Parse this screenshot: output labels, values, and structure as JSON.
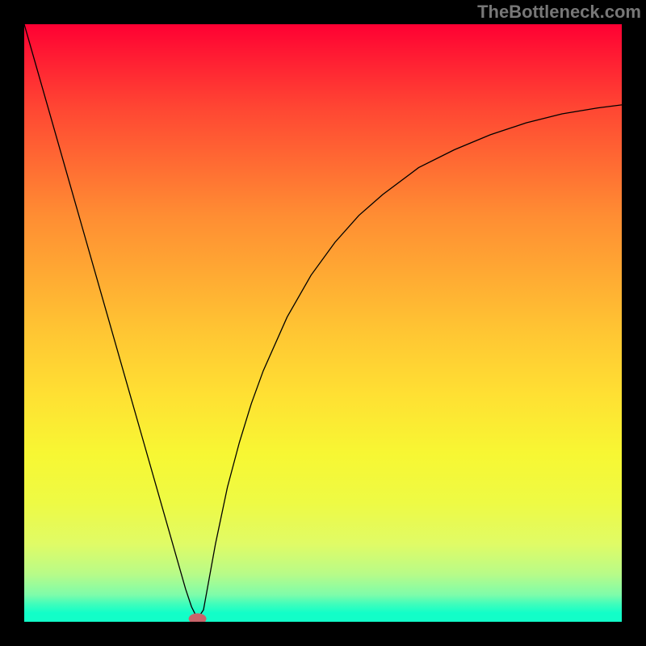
{
  "watermark": {
    "text": "TheBottleneck.com"
  },
  "chart_data": {
    "type": "line",
    "title": "",
    "xlabel": "",
    "ylabel": "",
    "xlim": [
      0,
      100
    ],
    "ylim": [
      0,
      100
    ],
    "series": [
      {
        "name": "bottleneck-curve",
        "x": [
          0,
          2,
          4,
          6,
          8,
          10,
          12,
          14,
          16,
          18,
          20,
          22,
          24,
          26,
          27,
          28,
          29,
          30,
          31,
          32,
          34,
          36,
          38,
          40,
          44,
          48,
          52,
          56,
          60,
          66,
          72,
          78,
          84,
          90,
          96,
          100
        ],
        "y": [
          100,
          93,
          86,
          79,
          72,
          65,
          58,
          51,
          44,
          37,
          30,
          23,
          16,
          9,
          5.5,
          2.5,
          0.5,
          2.0,
          7.5,
          13.0,
          22.5,
          30.0,
          36.5,
          42.0,
          51.0,
          58.0,
          63.5,
          68.0,
          71.5,
          76.0,
          79.0,
          81.5,
          83.5,
          85.0,
          86.0,
          86.5
        ]
      }
    ],
    "marker": {
      "x": 29,
      "y": 0.5
    },
    "background": {
      "type": "vertical-gradient",
      "stops": [
        {
          "pos": 0,
          "color": "#ff0033"
        },
        {
          "pos": 50,
          "color": "#ffc733"
        },
        {
          "pos": 85,
          "color": "#e0fb66"
        },
        {
          "pos": 100,
          "color": "#12fec8"
        }
      ]
    }
  }
}
